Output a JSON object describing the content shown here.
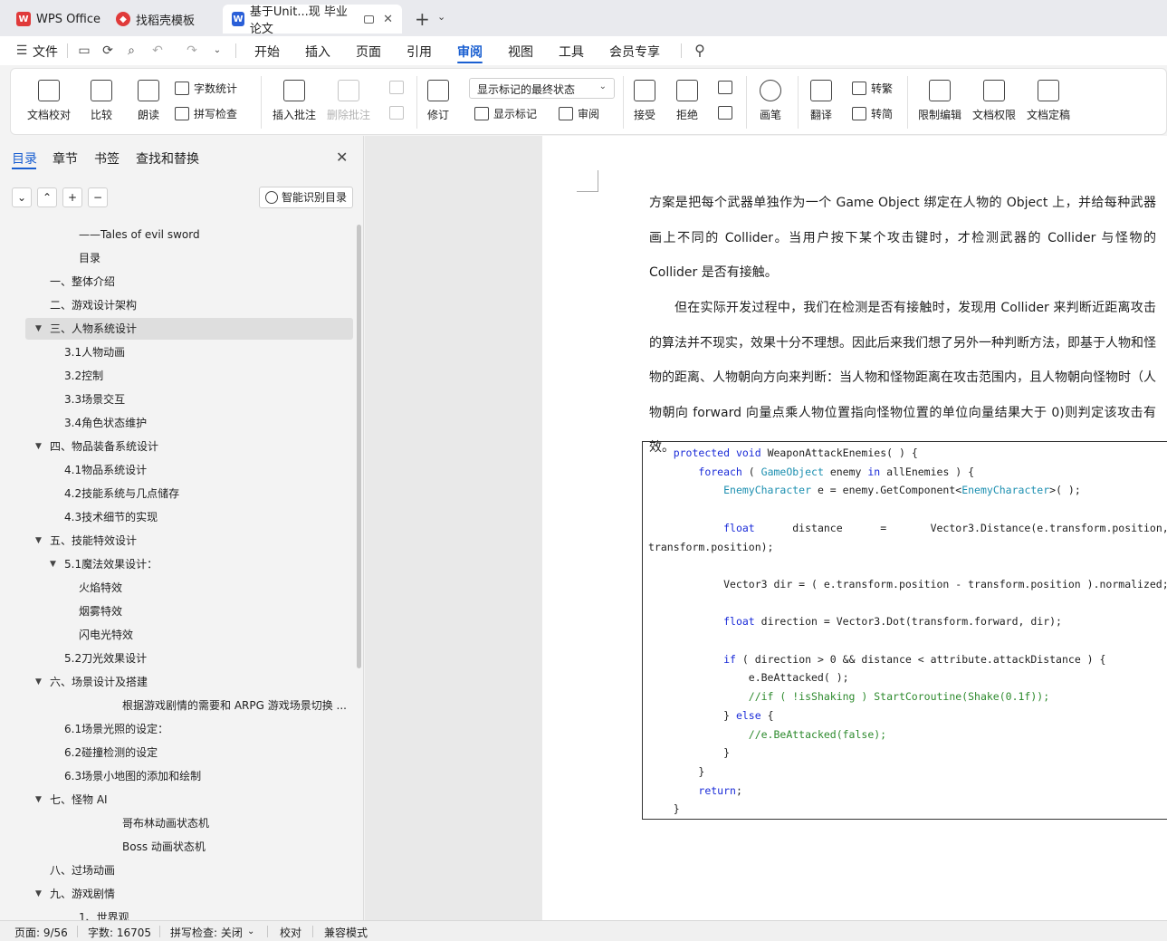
{
  "tabs": [
    {
      "label": "WPS Office",
      "icon": "wps-logo-icon",
      "color": "#e03a3a"
    },
    {
      "label": "找稻壳模板",
      "icon": "docer-icon",
      "color": "#e03a3a"
    },
    {
      "label": "基于Unit...现 毕业论文",
      "icon": "word-doc-icon",
      "color": "#2a5fd8"
    }
  ],
  "menubar": {
    "file": "文件",
    "items": [
      "开始",
      "插入",
      "页面",
      "引用",
      "审阅",
      "视图",
      "工具",
      "会员专享"
    ],
    "active": "审阅"
  },
  "ribbon": {
    "proofread": "文档校对",
    "compare": "比较",
    "read_aloud": "朗读",
    "word_count": "字数统计",
    "spell_check": "拼写检查",
    "insert_comment": "插入批注",
    "delete_comment": "删除批注",
    "revise": "修订",
    "markup_state": "显示标记的最终状态",
    "show_markup": "显示标记",
    "review": "审阅",
    "accept": "接受",
    "reject": "拒绝",
    "pen": "画笔",
    "translate": "翻译",
    "to_traditional": "转繁",
    "to_simplified": "转简",
    "restrict_edit": "限制编辑",
    "doc_permission": "文档权限",
    "doc_finalize": "文档定稿"
  },
  "left_panel": {
    "tabs": [
      "目录",
      "章节",
      "书签",
      "查找和替换"
    ],
    "smart_toc": "智能识别目录",
    "toc": [
      {
        "text": "——Tales of evil sword",
        "level": 3
      },
      {
        "text": "目录",
        "level": 3
      },
      {
        "text": "一、整体介绍",
        "level": 1
      },
      {
        "text": "二、游戏设计架构",
        "level": 1
      },
      {
        "text": "三、人物系统设计",
        "level": 1,
        "expanded": true,
        "selected": true
      },
      {
        "text": "3.1人物动画",
        "level": 2
      },
      {
        "text": "3.2控制",
        "level": 2
      },
      {
        "text": "3.3场景交互",
        "level": 2
      },
      {
        "text": "3.4角色状态维护",
        "level": 2
      },
      {
        "text": "四、物品装备系统设计",
        "level": 1,
        "expanded": true
      },
      {
        "text": "4.1物品系统设计",
        "level": 2
      },
      {
        "text": "4.2技能系统与几点储存",
        "level": 2
      },
      {
        "text": "4.3技术细节的实现",
        "level": 2
      },
      {
        "text": "五、技能特效设计",
        "level": 1,
        "expanded": true
      },
      {
        "text": "5.1魔法效果设计：",
        "level": 2,
        "expanded": true
      },
      {
        "text": "火焰特效",
        "level": 3
      },
      {
        "text": "烟雾特效",
        "level": 3
      },
      {
        "text": "闪电光特效",
        "level": 3
      },
      {
        "text": "5.2刀光效果设计",
        "level": 2
      },
      {
        "text": "六、场景设计及搭建",
        "level": 1,
        "expanded": true
      },
      {
        "text": "根据游戏剧情的需要和 ARPG 游戏场景切换 ...",
        "level": 4
      },
      {
        "text": "6.1场景光照的设定：",
        "level": 2
      },
      {
        "text": "6.2碰撞检测的设定",
        "level": 2
      },
      {
        "text": "6.3场景小地图的添加和绘制",
        "level": 2
      },
      {
        "text": "七、怪物 AI",
        "level": 1,
        "expanded": true
      },
      {
        "text": "哥布林动画状态机",
        "level": 4
      },
      {
        "text": "Boss 动画状态机",
        "level": 4
      },
      {
        "text": "八、过场动画",
        "level": 1
      },
      {
        "text": "九、游戏剧情",
        "level": 1,
        "expanded": true
      },
      {
        "text": "1、世界观",
        "level": 3
      }
    ]
  },
  "document": {
    "para1": "方案是把每个武器单独作为一个 Game Object 绑定在人物的 Object 上，并给每种武器画上不同的 Collider。当用户按下某个攻击键时，才检测武器的 Collider 与怪物的 Collider 是否有接触。",
    "para2": "但在实际开发过程中，我们在检测是否有接触时，发现用 Collider 来判断近距离攻击的算法并不现实，效果十分不理想。因此后来我们想了另外一种判断方法，即基于人物和怪物的距离、人物朝向方向来判断：当人物和怪物距离在攻击范围内，且人物朝向怪物时（人物朝向 forward 向量点乘人物位置指向怪物位置的单位向量结果大于 0)则判定该攻击有效。",
    "code": [
      "    protected void WeaponAttackEnemies( ) {",
      "        foreach ( GameObject enemy in allEnemies ) {",
      "            EnemyCharacter e = enemy.GetComponent<EnemyCharacter>( );",
      "",
      "            float      distance      =       Vector3.Distance(e.transform.position,",
      "transform.position);",
      "",
      "            Vector3 dir = ( e.transform.position - transform.position ).normalized;",
      "",
      "            float direction = Vector3.Dot(transform.forward, dir);",
      "",
      "            if ( direction > 0 && distance < attribute.attackDistance ) {",
      "                e.BeAttacked( );",
      "                //if ( !isShaking ) StartCoroutine(Shake(0.1f));",
      "            } else {",
      "                //e.BeAttacked(false);",
      "            }",
      "        }",
      "        return;",
      "    }"
    ]
  },
  "statusbar": {
    "page": "页面: 9/56",
    "words": "字数: 16705",
    "spell": "拼写检查: 关闭",
    "proof": "校对",
    "compat": "兼容模式"
  },
  "colors": {
    "accent": "#1a5fd1",
    "keyword": "#1a2bd8",
    "type": "#1c8fb0",
    "comment": "#2d8a2d"
  }
}
